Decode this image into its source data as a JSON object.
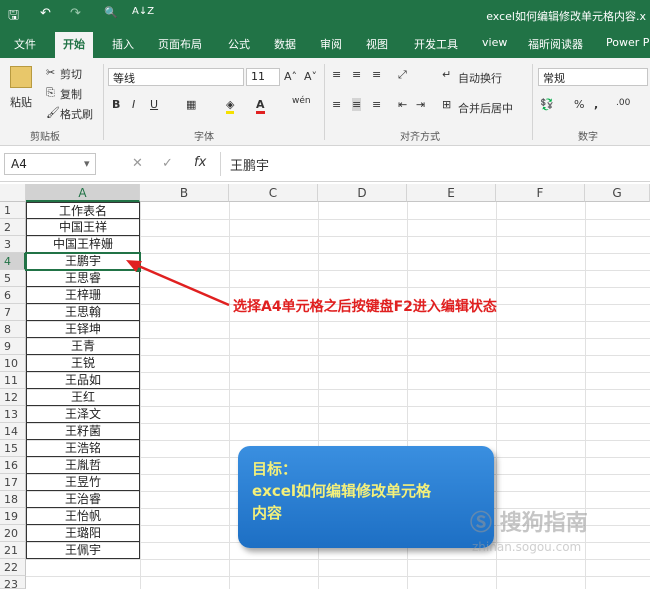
{
  "window": {
    "title": "excel如何编辑修改单元格内容.x"
  },
  "quick_access": {
    "save": "🖫",
    "undo": "↶",
    "redo": "↷",
    "preview": "🔍",
    "sort": "A↓Z"
  },
  "tabs": [
    "文件",
    "开始",
    "插入",
    "页面布局",
    "公式",
    "数据",
    "审阅",
    "视图",
    "开发工具",
    "view",
    "福昕阅读器",
    "Power P"
  ],
  "ribbon": {
    "clipboard": {
      "paste": "粘贴",
      "cut": "剪切",
      "copy": "复制",
      "format_painter": "格式刷",
      "group": "剪贴板"
    },
    "font": {
      "name": "等线",
      "size": "11",
      "grow": "A˄",
      "shrink": "A˅",
      "bold": "B",
      "italic": "I",
      "underline": "U",
      "phonetic": "wén",
      "group": "字体"
    },
    "alignment": {
      "wrap": "自动换行",
      "merge": "合并后居中",
      "group": "对齐方式"
    },
    "number": {
      "format": "常规",
      "percent": "%",
      "comma": ",",
      "group": "数字"
    }
  },
  "formula_bar": {
    "name_box": "A4",
    "cancel": "✕",
    "enter": "✓",
    "fx": "fx",
    "value": "王鹏宇"
  },
  "sheet": {
    "columns": [
      "A",
      "B",
      "C",
      "D",
      "E",
      "F",
      "G"
    ],
    "rows": [
      "1",
      "2",
      "3",
      "4",
      "5",
      "6",
      "7",
      "8",
      "9",
      "10",
      "11",
      "12",
      "13",
      "14",
      "15",
      "16",
      "17",
      "18",
      "19",
      "20",
      "21",
      "22",
      "23"
    ],
    "col_a": [
      "工作表名",
      "中国王祥",
      "中国王梓姗",
      "王鹏宇",
      "王思睿",
      "王梓珊",
      "王思翰",
      "王铎坤",
      "王青",
      "王锐",
      "王品如",
      "王红",
      "王泽文",
      "王籽菌",
      "王浩铭",
      "王胤哲",
      "王昱竹",
      "王治睿",
      "王怡帆",
      "王璐阳",
      "王佩宇"
    ],
    "selected_cell": "A4"
  },
  "annotation": {
    "text": "选择A4单元格之后按键盘F2进入编辑状态",
    "color": "#e02020"
  },
  "goal_box": {
    "label": "目标：",
    "line1": "excel如何编辑修改单元格",
    "line2": "内容"
  },
  "watermark": {
    "text": "搜狗指南",
    "url": "zhinan.sogou.com"
  },
  "colors": {
    "accent": "#217346",
    "annotation": "#e02020",
    "goal_bg": "#2a7fd6"
  }
}
